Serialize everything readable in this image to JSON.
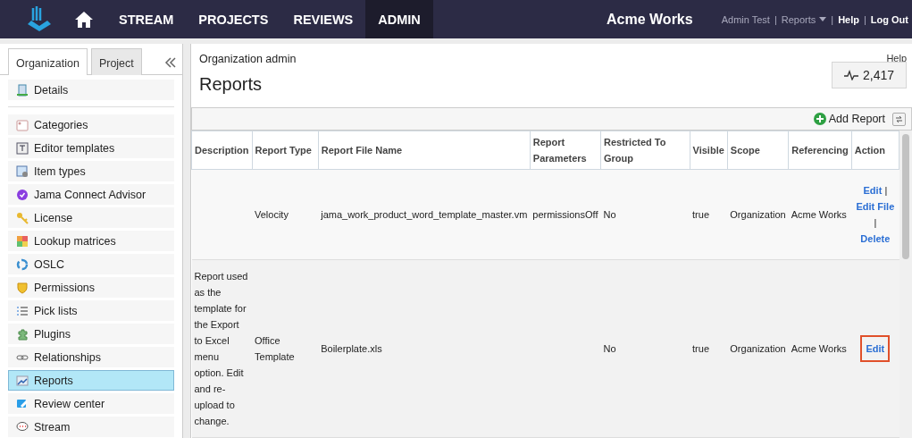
{
  "topbar": {
    "nav": [
      {
        "label": "STREAM",
        "selected": false
      },
      {
        "label": "PROJECTS",
        "selected": false
      },
      {
        "label": "REVIEWS",
        "selected": false
      },
      {
        "label": "ADMIN",
        "selected": true
      }
    ],
    "org": "Acme Works",
    "separator": "|",
    "user": "Admin Test",
    "reports": "Reports",
    "help": "Help",
    "logout": "Log Out"
  },
  "sidebar": {
    "tabs": [
      {
        "label": "Organization",
        "selected": true
      },
      {
        "label": "Project",
        "selected": false
      }
    ],
    "top_item": {
      "label": "Details",
      "selected": false
    },
    "items": [
      {
        "label": "Categories",
        "selected": false
      },
      {
        "label": "Editor templates",
        "selected": false
      },
      {
        "label": "Item types",
        "selected": false
      },
      {
        "label": "Jama Connect Advisor",
        "selected": false
      },
      {
        "label": "License",
        "selected": false
      },
      {
        "label": "Lookup matrices",
        "selected": false
      },
      {
        "label": "OSLC",
        "selected": false
      },
      {
        "label": "Permissions",
        "selected": false
      },
      {
        "label": "Pick lists",
        "selected": false
      },
      {
        "label": "Plugins",
        "selected": false
      },
      {
        "label": "Relationships",
        "selected": false
      },
      {
        "label": "Reports",
        "selected": true
      },
      {
        "label": "Review center",
        "selected": false
      },
      {
        "label": "Stream",
        "selected": false
      }
    ]
  },
  "main": {
    "breadcrumb": "Organization admin",
    "help": "Help",
    "title": "Reports",
    "count": "2,417",
    "add_button": "Add Report",
    "table": {
      "columns": [
        "Description",
        "Report Type",
        "Report File Name",
        "Report Parameters",
        "Restricted To Group",
        "Visible",
        "Scope",
        "Referencing",
        "Action"
      ],
      "rows": [
        {
          "action_separator": "|",
          "cells": [
            "",
            "Velocity",
            "jama_work_product_word_template_master.vm",
            "permissionsOff",
            "No",
            "true",
            "Organization",
            "Acme Works"
          ],
          "actions": [
            {
              "label": "Edit",
              "highlighted": false
            },
            {
              "label": "Edit File",
              "highlighted": false
            },
            {
              "label": "Delete",
              "highlighted": false
            }
          ]
        },
        {
          "cells": [
            "Report used as the template for the Export to Excel menu option. Edit and re-upload to change.",
            "Office Template",
            "Boilerplate.xls",
            "",
            "No",
            "true",
            "Organization",
            "Acme Works"
          ],
          "actions": [
            {
              "label": "Edit",
              "highlighted": true
            }
          ]
        }
      ]
    }
  }
}
